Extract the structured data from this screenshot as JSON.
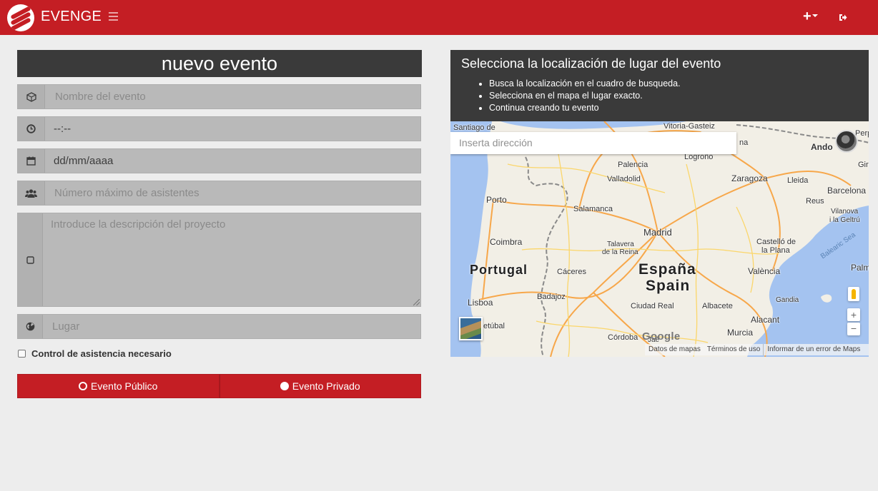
{
  "navbar": {
    "brand": "EVENGE",
    "colors": {
      "primary": "#c41e24"
    },
    "icons": {
      "menu": "bars-icon",
      "add": "plus-icon",
      "logout": "sign-out-icon"
    }
  },
  "form": {
    "title": "nuevo evento",
    "fields": {
      "name": {
        "placeholder": "Nombre del evento",
        "icon": "cube-icon"
      },
      "time": {
        "value": "--:--",
        "icon": "clock-icon"
      },
      "date": {
        "value": "dd/mm/aaaa",
        "icon": "calendar-icon"
      },
      "attendees": {
        "placeholder": "Número máximo de asistentes",
        "icon": "users-icon"
      },
      "description": {
        "placeholder": "Introduce la descripción del proyecto",
        "icon": "square-icon"
      },
      "place": {
        "placeholder": "Lugar",
        "icon": "globe-icon"
      }
    },
    "attendance_checkbox": {
      "label": "Control de asistencia necesario",
      "checked": false
    },
    "visibility": {
      "options": [
        {
          "label": "Evento Público",
          "selected": false
        },
        {
          "label": "Evento Privado",
          "selected": true
        }
      ]
    }
  },
  "map_panel": {
    "title": "Selecciona la localización de lugar del evento",
    "steps": [
      "Busca la localización en el cuadro de busqueda.",
      "Selecciona en el mapa el lugar exacto.",
      "Continua creando tu evento"
    ],
    "search": {
      "placeholder": "Inserta dirección"
    },
    "labels": {
      "santiago": "Santiago de",
      "vitoria": "Vitoria-Gasteiz",
      "logrono": "Logroño",
      "palencia": "Palencia",
      "valladolid": "Valladolid",
      "zaragoza": "Zaragoza",
      "lleida": "Lleida",
      "barcelona": "Barcelona",
      "porto": "Porto",
      "salamanca": "Salamanca",
      "reus": "Reus",
      "vilanova1": "Vilanova",
      "vilanova2": "i la Geltrú",
      "madrid": "Madrid",
      "coimbra": "Coimbra",
      "talavera1": "Talavera",
      "talavera2": "de la Reina",
      "castello1": "Castelló de",
      "castello2": "la Plana",
      "portugal": "Portugal",
      "caceres": "Cáceres",
      "espana": "España",
      "spain": "Spain",
      "valencia": "València",
      "lisboa": "Lisboa",
      "badajoz": "Badajoz",
      "ciudad_real": "Ciudad Real",
      "albacete": "Albacete",
      "gandia": "Gandia",
      "setubal": "etúbal",
      "alacant": "Alacant",
      "cordoba": "Córdoba",
      "murcia": "Murcia",
      "andorra": "Ando",
      "perp": "Perp",
      "gir": "Gir",
      "palma": "Palm",
      "na": "na",
      "sea": "Balearic Sea",
      "jaen": "Jaé"
    },
    "zoom_in": "+",
    "zoom_out": "−",
    "google": "Google",
    "footer": {
      "data": "Datos de mapas",
      "terms": "Términos de uso",
      "report": "Informar de un error de Maps"
    }
  }
}
